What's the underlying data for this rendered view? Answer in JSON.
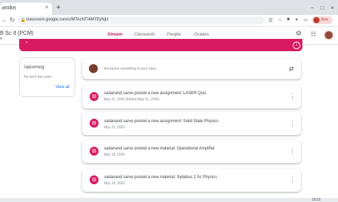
{
  "browser": {
    "tab_title": "आपकेरा",
    "tab_close": "×",
    "new_tab": "+",
    "window_controls": [
      "−",
      "□",
      "×"
    ],
    "back": "←",
    "reload": "↻",
    "url": "classroom.google.com/c/MTAzNTI4MTEyNjIz",
    "profile_label": "Erro"
  },
  "header": {
    "class_name": "B Sc II (PCM)",
    "class_sub": "A",
    "tabs": [
      {
        "label": "Stream"
      },
      {
        "label": "Classwork"
      },
      {
        "label": "People"
      },
      {
        "label": "Grades"
      }
    ]
  },
  "upcoming": {
    "title": "Upcoming",
    "empty_text": "No work due soon",
    "view_all": "View all"
  },
  "announce": {
    "placeholder": "Announce something to your class"
  },
  "posts": [
    {
      "title": "sadanand sarve posted a new assignment: LASER Quiz",
      "date": "May 21, 2020 (Edited May 21, 2020)",
      "icon": "assignment-icon"
    },
    {
      "title": "sadanand sarve posted a new assignment: Solid State Physics",
      "date": "May 21, 2020",
      "icon": "assignment-icon"
    },
    {
      "title": "sadanand sarve posted a new material: Operational Amplifier",
      "date": "May 18, 2020",
      "icon": "material-icon"
    },
    {
      "title": "sadanand sarve posted a new material: Syllabus 2 Sc Physics",
      "date": "May 18, 2020",
      "icon": "material-icon"
    }
  ],
  "taskbar": {
    "clock": "15:21"
  },
  "colors": {
    "accent": "#d81b60",
    "tab_active": "#c2185b",
    "link": "#1a73e8"
  }
}
